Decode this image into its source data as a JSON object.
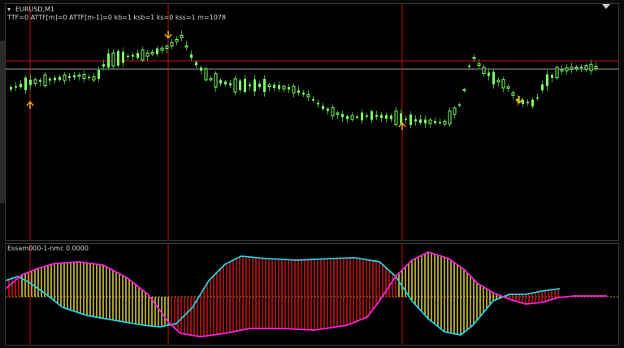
{
  "main_chart": {
    "symbol_title": "EURUSD,M1",
    "indicator_params": "TTF=0 ATTF[m]=0 ATTF[m-1]=0 kb=1 ksb=1 ks=0 kss=1 m=1078",
    "colors": {
      "background": "#000000",
      "candle_bull": "#7fff66",
      "candle_wick": "#39a838",
      "crosshair": "#c01010",
      "level_line": "#a0a0a0",
      "signal_arrow": "#f0a020"
    }
  },
  "sub_chart": {
    "indicator_title": "Essam000-1-nmc 0.0000",
    "colors": {
      "hist_up": "#f0e040",
      "hist_down": "#e01818",
      "line_cyan": "#22d4e8",
      "line_magenta": "#ff22dd",
      "zero_line": "#c8a000"
    }
  },
  "icons": {
    "menu": "triangle-down-icon",
    "corner": "triangle-down-icon",
    "arrows": "up-arrow-icon"
  }
}
